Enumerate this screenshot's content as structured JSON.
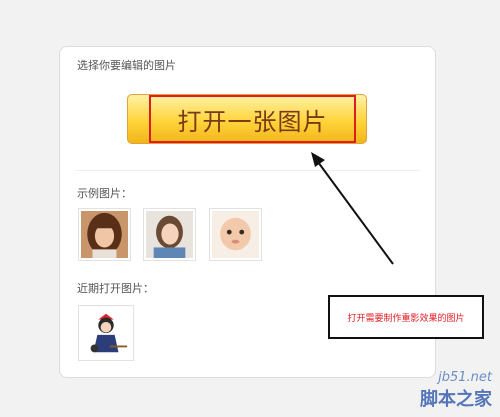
{
  "panel": {
    "title": "选择你要编辑的图片",
    "open_button_label": "打开一张图片",
    "examples_label": "示例图片：",
    "recent_label": "近期打开图片："
  },
  "example_images": [
    {
      "icon": "portrait-woman-brown-hair"
    },
    {
      "icon": "portrait-woman-smiling"
    },
    {
      "icon": "portrait-baby"
    }
  ],
  "recent_images": [
    {
      "icon": "cartoon-witch-girl"
    }
  ],
  "annotation": {
    "text": "打开需要制作重影效果的图片",
    "color": "#e11b22"
  },
  "watermark": {
    "site": "jb51.net",
    "name": "脚本之家"
  },
  "colors": {
    "button_gradient_top": "#fff2a6",
    "button_gradient_mid": "#ffd43b",
    "highlight_border": "#e11b22"
  }
}
